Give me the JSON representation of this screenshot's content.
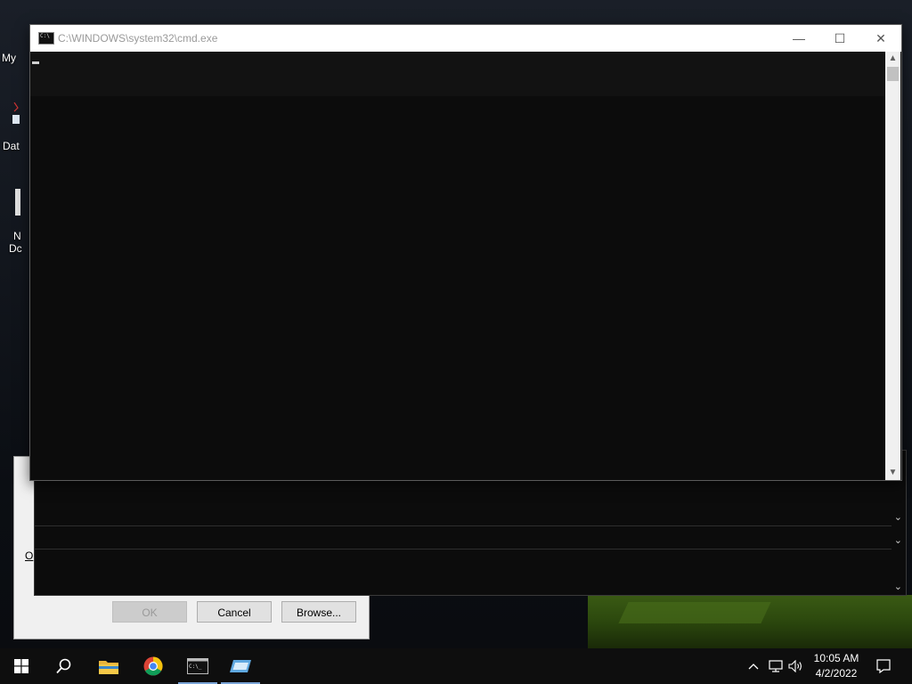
{
  "desktop": {
    "icons": [
      {
        "label": "My"
      },
      {
        "label": "Dat"
      },
      {
        "label": "N"
      },
      {
        "label": "Dc"
      }
    ]
  },
  "run_dialog": {
    "ok_label": "OK",
    "cancel_label": "Cancel",
    "browse_label": "Browse...",
    "open_label_fragment": "O"
  },
  "cmd_window": {
    "title": "C:\\WINDOWS\\system32\\cmd.exe",
    "minimize_glyph": "—",
    "maximize_glyph": "☐",
    "close_glyph": "✕"
  },
  "taskbar": {
    "apps": [
      {
        "name": "start-button",
        "icon": "windows-logo"
      },
      {
        "name": "search",
        "icon": "search-icon"
      },
      {
        "name": "file-explorer",
        "icon": "folder-icon"
      },
      {
        "name": "chrome",
        "icon": "chrome-icon"
      },
      {
        "name": "command-prompt",
        "icon": "cmd-icon",
        "active": true
      },
      {
        "name": "app-window",
        "icon": "window-icon",
        "active": true
      }
    ],
    "tray": {
      "chevron": "^",
      "time": "10:05 AM",
      "date": "4/2/2022"
    }
  },
  "colors": {
    "taskbar_bg": "#0e0e0e",
    "console_bg": "#0c0c0c",
    "titlebar_bg": "#ffffff",
    "active_indicator": "#7aa4d6"
  }
}
